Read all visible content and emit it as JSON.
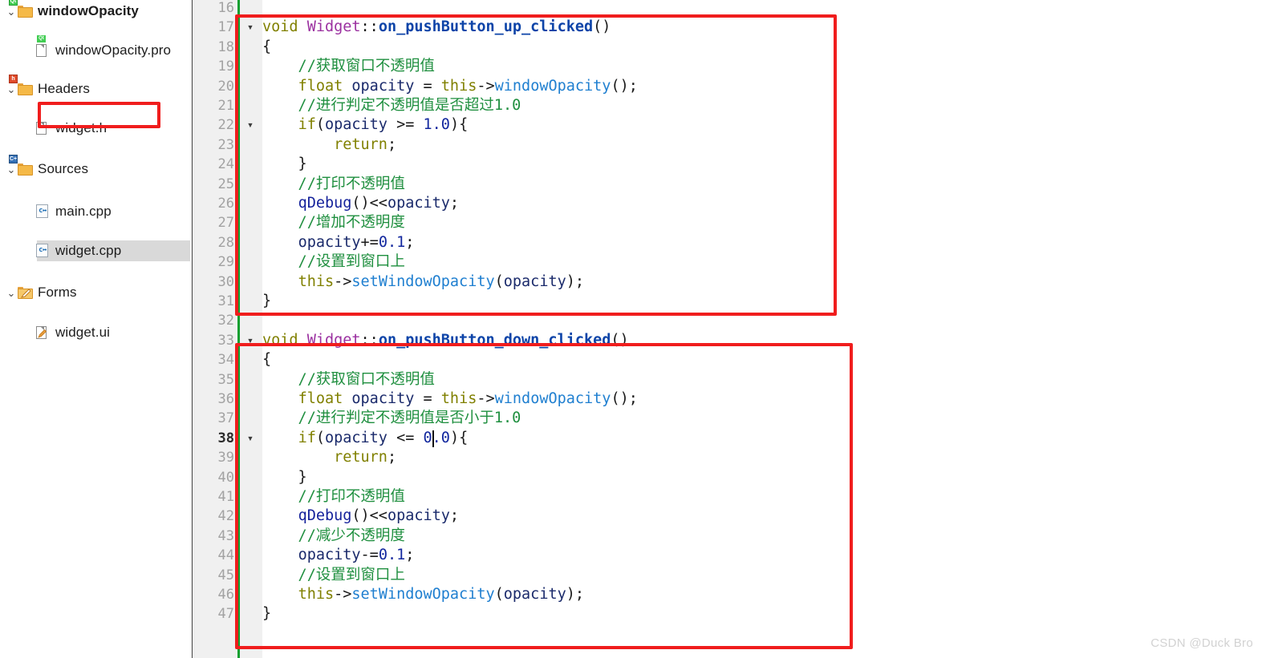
{
  "project_tree": {
    "name": "project-file-tree",
    "items": [
      {
        "label": "windowOpacity",
        "icon": "qt-project-folder-icon",
        "indent": 0,
        "chevron": "v",
        "bold": true,
        "selected": false,
        "highlighted": false
      },
      {
        "label": "windowOpacity.pro",
        "icon": "qt-pro-file-icon",
        "indent": 1,
        "chevron": "",
        "bold": false,
        "selected": false,
        "highlighted": false
      },
      {
        "label": "Headers",
        "icon": "headers-folder-icon",
        "indent": 0,
        "chevron": "v",
        "bold": false,
        "selected": false,
        "highlighted": false
      },
      {
        "label": "widget.h",
        "icon": "header-file-icon",
        "indent": 1,
        "chevron": "",
        "bold": false,
        "selected": false,
        "highlighted": false
      },
      {
        "label": "Sources",
        "icon": "sources-folder-icon",
        "indent": 0,
        "chevron": "v",
        "bold": false,
        "selected": false,
        "highlighted": false
      },
      {
        "label": "main.cpp",
        "icon": "cpp-file-icon",
        "indent": 1,
        "chevron": "",
        "bold": false,
        "selected": false,
        "highlighted": false
      },
      {
        "label": "widget.cpp",
        "icon": "cpp-file-icon",
        "indent": 1,
        "chevron": "",
        "bold": false,
        "selected": true,
        "highlighted": true
      },
      {
        "label": "Forms",
        "icon": "forms-folder-icon",
        "indent": 0,
        "chevron": "v",
        "bold": false,
        "selected": false,
        "highlighted": false
      },
      {
        "label": "widget.ui",
        "icon": "ui-file-icon",
        "indent": 1,
        "chevron": "",
        "bold": false,
        "selected": false,
        "highlighted": false
      }
    ]
  },
  "editor": {
    "name": "code-editor",
    "language": "cpp",
    "first_visible_line": 16,
    "current_line": 38,
    "caret": {
      "line": 38,
      "column": 20,
      "after_text": "    if(opacity <= 0"
    },
    "fold_marker_lines": [
      17,
      22,
      33,
      38
    ],
    "lines": [
      {
        "n": 16,
        "text": ""
      },
      {
        "n": 17,
        "text": "void Widget::on_pushButton_up_clicked()"
      },
      {
        "n": 18,
        "text": "{"
      },
      {
        "n": 19,
        "text": "    //获取窗口不透明值"
      },
      {
        "n": 20,
        "text": "    float opacity = this->windowOpacity();"
      },
      {
        "n": 21,
        "text": "    //进行判定不透明值是否超过1.0"
      },
      {
        "n": 22,
        "text": "    if(opacity >= 1.0){"
      },
      {
        "n": 23,
        "text": "        return;"
      },
      {
        "n": 24,
        "text": "    }"
      },
      {
        "n": 25,
        "text": "    //打印不透明值"
      },
      {
        "n": 26,
        "text": "    qDebug()<<opacity;"
      },
      {
        "n": 27,
        "text": "    //增加不透明度"
      },
      {
        "n": 28,
        "text": "    opacity+=0.1;"
      },
      {
        "n": 29,
        "text": "    //设置到窗口上"
      },
      {
        "n": 30,
        "text": "    this->setWindowOpacity(opacity);"
      },
      {
        "n": 31,
        "text": "}"
      },
      {
        "n": 32,
        "text": ""
      },
      {
        "n": 33,
        "text": "void Widget::on_pushButton_down_clicked()"
      },
      {
        "n": 34,
        "text": "{"
      },
      {
        "n": 35,
        "text": "    //获取窗口不透明值"
      },
      {
        "n": 36,
        "text": "    float opacity = this->windowOpacity();"
      },
      {
        "n": 37,
        "text": "    //进行判定不透明值是否小于1.0"
      },
      {
        "n": 38,
        "text": "    if(opacity <= 0.0){"
      },
      {
        "n": 39,
        "text": "        return;"
      },
      {
        "n": 40,
        "text": "    }"
      },
      {
        "n": 41,
        "text": "    //打印不透明值"
      },
      {
        "n": 42,
        "text": "    qDebug()<<opacity;"
      },
      {
        "n": 43,
        "text": "    //减少不透明度"
      },
      {
        "n": 44,
        "text": "    opacity-=0.1;"
      },
      {
        "n": 45,
        "text": "    //设置到窗口上"
      },
      {
        "n": 46,
        "text": "    this->setWindowOpacity(opacity);"
      },
      {
        "n": 47,
        "text": "}"
      }
    ]
  },
  "annotations": {
    "box_color": "#f01d1d",
    "boxes": [
      {
        "name": "redbox-up-function",
        "covers_lines": "17-31"
      },
      {
        "name": "redbox-down-function",
        "covers_lines": "33-47"
      },
      {
        "name": "redbox-widget-cpp",
        "covers": "widget.cpp"
      }
    ]
  },
  "watermark": {
    "text": "CSDN @Duck Bro"
  },
  "colors": {
    "keyword": "#808000",
    "class_name": "#9b30a0",
    "function_def": "#0d44a8",
    "function_call": "#1f7fd0",
    "identifier": "#1a2a6b",
    "number": "#12279e",
    "comment": "#1f8f3f",
    "gutter_bg": "#f0f0f0",
    "change_bar": "#0f9f2f",
    "selection_bg": "#d9d9d9",
    "annotation_red": "#f01d1d"
  }
}
